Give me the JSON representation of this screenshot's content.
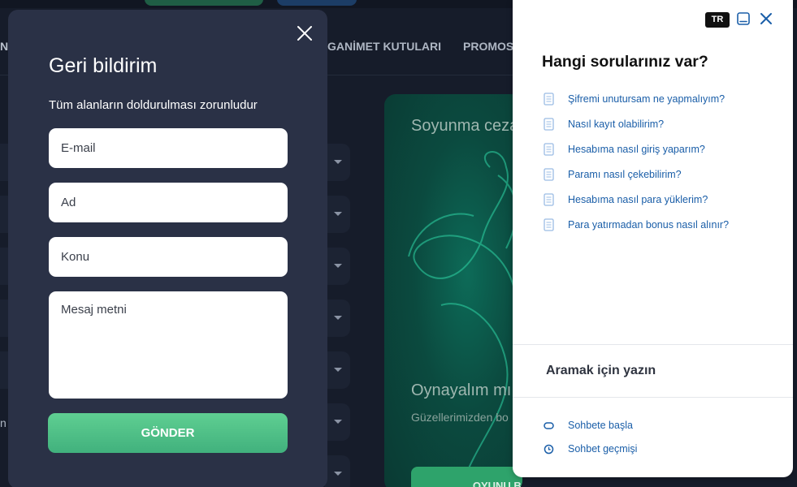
{
  "background": {
    "nav_left_fragment": "N",
    "nav_items": [
      "GANİMET KUTULARI",
      "PROMOS"
    ],
    "side_fragment": "n",
    "card": {
      "title_fragment": "Soyunma ceza",
      "subtitle_fragment": "Oynayalım mı",
      "text_fragment": "Güzellerimizden bo",
      "button_fragment": "OYUNU BAŞLAT"
    }
  },
  "feedback": {
    "title": "Geri bildirim",
    "required_note": "Tüm alanların doldurulması zorunludur",
    "fields": {
      "email_placeholder": "E-mail",
      "name_placeholder": "Ad",
      "subject_placeholder": "Konu",
      "message_placeholder": "Mesaj metni"
    },
    "submit_label": "GÖNDER",
    "close_icon": "close-icon"
  },
  "help": {
    "language": "TR",
    "title": "Hangi sorularınız var?",
    "questions": [
      "Şifremi unutursam ne yapmalıyım?",
      "Nasıl kayıt olabilirim?",
      "Hesabıma nasıl giriş yaparım?",
      "Paramı nasıl çekebilirim?",
      "Hesabıma nasıl para yüklerim?",
      "Para yatırmadan bonus nasıl alınır?"
    ],
    "search_label": "Aramak için yazın",
    "actions": {
      "start_chat": "Sohbete başla",
      "chat_history": "Sohbet geçmişi"
    },
    "colors": {
      "link": "#1a5ea8",
      "icon": "#9bbce4",
      "accent": "#1a5ea8"
    }
  },
  "colors": {
    "modal_bg": "#2a3146",
    "page_bg": "#161c2a",
    "send_button": "#4fc186"
  }
}
